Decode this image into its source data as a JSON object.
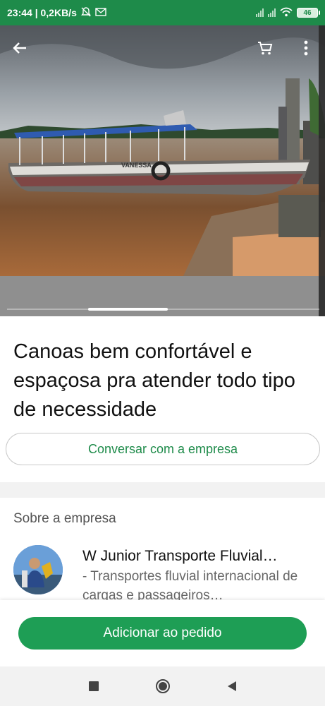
{
  "status_bar": {
    "time_speed": "23:44 | 0,2KB/s",
    "battery": "46"
  },
  "product": {
    "title": "Canoas bem confortável e espaçosa pra atender todo tipo de necessidade",
    "image_count_position": "2 of 4",
    "boat_name": "VANESSA"
  },
  "actions": {
    "chat_label": "Conversar com a empresa",
    "add_label": "Adicionar ao pedido"
  },
  "about": {
    "section_label": "Sobre a empresa",
    "company_name": "W Junior Transporte Fluvial…",
    "company_description": "- Transportes fluvial internacional de cargas e passageiros…"
  },
  "icons": {
    "back": "arrow-left-icon",
    "cart": "shopping-cart-icon",
    "more": "more-vertical-icon"
  },
  "colors": {
    "brand_green": "#1e8b4a",
    "button_green": "#1e9e55"
  }
}
